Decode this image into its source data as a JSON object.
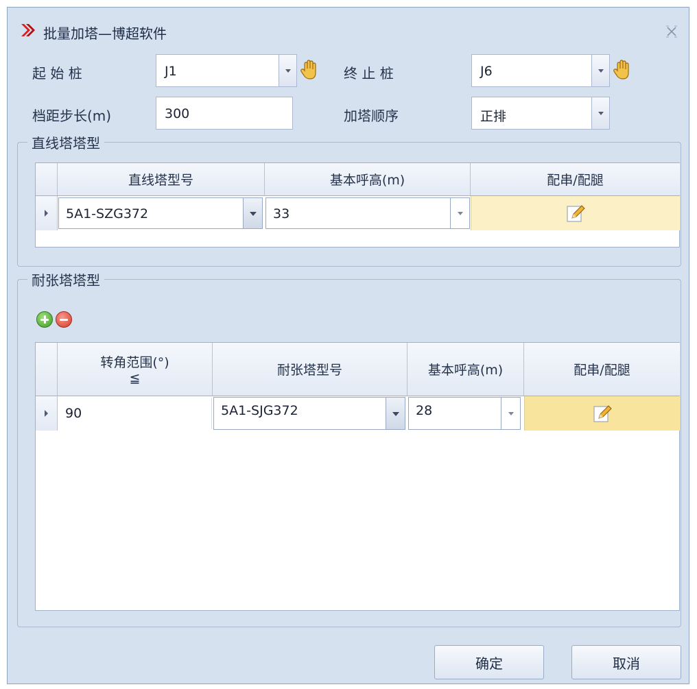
{
  "window": {
    "title": "批量加塔—博超软件"
  },
  "form": {
    "start_pile_label": "起 始 桩",
    "start_pile_value": "J1",
    "end_pile_label": "终 止 桩",
    "end_pile_value": "J6",
    "span_step_label": "档距步长(m)",
    "span_step_value": "300",
    "order_label": "加塔顺序",
    "order_value": "正排"
  },
  "straight_group": {
    "title": "直线塔塔型",
    "columns": [
      "直线塔型号",
      "基本呼高(m)",
      "配串/配腿"
    ],
    "rows": [
      {
        "model": "5A1-SZG372",
        "height": "33",
        "action_icon": "pencil-icon"
      }
    ]
  },
  "tension_group": {
    "title": "耐张塔塔型",
    "toolbar": {
      "add_icon": "plus-circle-icon",
      "remove_icon": "minus-circle-icon"
    },
    "col_angle_line1": "转角范围(°)",
    "col_angle_line2": "≦",
    "col_model": "耐张塔型号",
    "col_height": "基本呼高(m)",
    "col_action": "配串/配腿",
    "rows": [
      {
        "angle": "90",
        "model": "5A1-SJG372",
        "height": "28",
        "action_icon": "pencil-icon"
      }
    ]
  },
  "buttons": {
    "ok": "确定",
    "cancel": "取消"
  },
  "colors": {
    "window_bg": "#d6e1f0",
    "edit_cell_bg": "#fbf0c6",
    "edit_cell_selected": "#f8e49c",
    "app_icon": "#d81e1e"
  }
}
